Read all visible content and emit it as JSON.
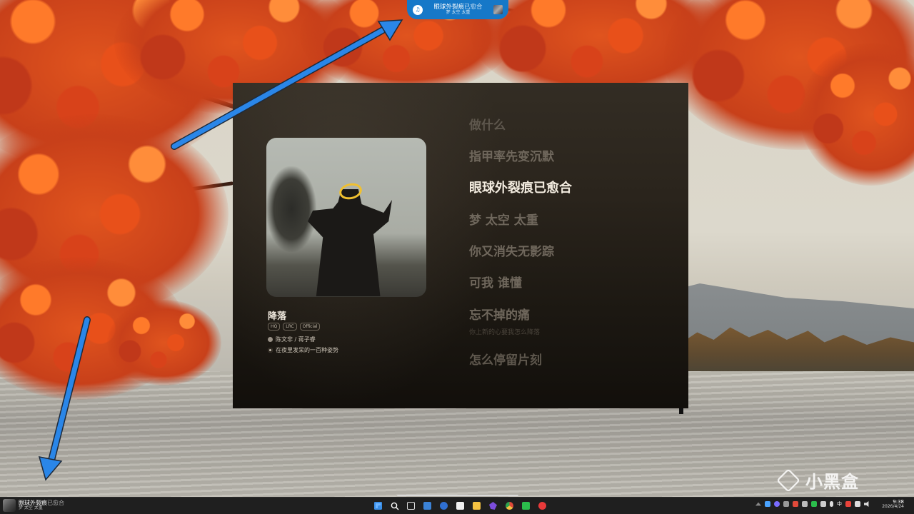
{
  "island": {
    "title_main": "眼球外裂痕",
    "title_rest": "已愈合",
    "subtitle": "梦 太空 太重",
    "logo_glyph": "♫"
  },
  "player": {
    "track_title": "降落",
    "tags": [
      "HQ",
      "LRC",
      "Official"
    ],
    "artists": "陈文非 / 蒋子睿",
    "album": "在夜里发呆的一百种姿势",
    "lyrics": [
      {
        "text": "做什么",
        "state": "faint"
      },
      {
        "text": "指甲率先变沉默",
        "state": "mid"
      },
      {
        "text": "眼球外裂痕已愈合",
        "state": "active"
      },
      {
        "text": "梦 太空 太重",
        "state": "mid"
      },
      {
        "text": "你又消失无影踪",
        "state": "mid"
      },
      {
        "text": "可我 谁懂",
        "state": "mid"
      },
      {
        "text": "忘不掉的痛",
        "state": "mid"
      },
      {
        "text": "你上新的心要我怎么降落",
        "state": "sub"
      },
      {
        "text": "怎么停留片刻",
        "state": "faint"
      }
    ]
  },
  "taskbar": {
    "media_title_main": "眼球外裂痕",
    "media_title_rest": "已愈合",
    "media_subtitle": "梦 太空 太重",
    "apps": [
      {
        "name": "start-icon",
        "color": "#3a8ee6"
      },
      {
        "name": "search-icon",
        "color": "#2b2b2b"
      },
      {
        "name": "task-view-icon",
        "color": "#2b2b2b"
      },
      {
        "name": "notes-icon",
        "color": "#3b82d6"
      },
      {
        "name": "todo-icon",
        "color": "#2f6fd1"
      },
      {
        "name": "typora-icon",
        "color": "#f0f0f0"
      },
      {
        "name": "file-explorer-icon",
        "color": "#f5c242"
      },
      {
        "name": "obsidian-icon",
        "color": "#7c4ddc"
      },
      {
        "name": "chrome-icon",
        "color": "#e04a3a"
      },
      {
        "name": "wechat-icon",
        "color": "#2bbd4c"
      },
      {
        "name": "netease-music-icon",
        "color": "#e83a3a"
      }
    ],
    "tray_lang": "中",
    "time": "9:38",
    "date": "2026/4/24"
  },
  "watermark": {
    "text": "小黑盒"
  },
  "colors": {
    "island_bg": "#1678c8",
    "arrow": "#2a86e8",
    "active_lyric": "#f3ece0"
  }
}
